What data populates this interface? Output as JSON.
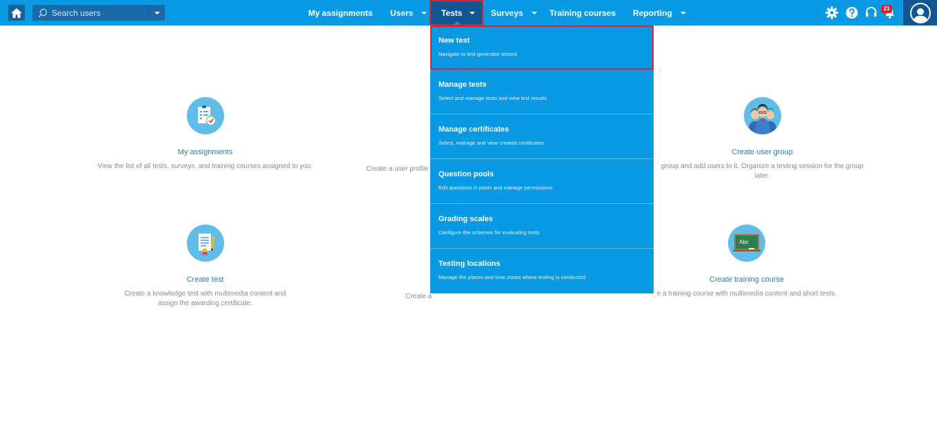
{
  "header": {
    "search": {
      "placeholder": "Search users",
      "value": ""
    },
    "nav": [
      {
        "label": "My assignments"
      },
      {
        "label": "Users"
      },
      {
        "label": "Tests"
      },
      {
        "label": "Surveys"
      },
      {
        "label": "Training courses"
      },
      {
        "label": "Reporting"
      }
    ],
    "notification_count": "21",
    "icons": [
      "home-icon",
      "search-icon",
      "gear-icon",
      "help-icon",
      "headset-icon",
      "bell-icon",
      "user-avatar-icon"
    ]
  },
  "cards": [
    {
      "title": "My assignments",
      "desc": "View the list of all tests, surveys, and training courses assigned to you."
    },
    {
      "title": "",
      "desc": "Create a user profile"
    },
    {
      "title": "Create user group",
      "desc": "group and add users to it. Organize a testing session for the group later."
    },
    {
      "title": "Create test",
      "desc": "Create a knowledge test with multimedia content and assign the awarding certificate."
    },
    {
      "title": "",
      "desc": "Create a"
    },
    {
      "title": "Create training course",
      "desc": "e a training course with multimedia content and short tests."
    }
  ],
  "tests_menu": [
    {
      "title": "New test",
      "sub": "Navigate to test generator wizard"
    },
    {
      "title": "Manage tests",
      "sub": "Select and manage tests and view test results"
    },
    {
      "title": "Manage certificates",
      "sub": "Select, manage and view created certificates"
    },
    {
      "title": "Question pools",
      "sub": "Edit questions in pools and manage permissions"
    },
    {
      "title": "Grading scales",
      "sub": "Configure the schemes for evaluating tests"
    },
    {
      "title": "Testing locations",
      "sub": "Manage the places and time zones where testing is conducted"
    }
  ],
  "colors": {
    "primary": "#0a9ae4",
    "dark": "#125793",
    "highlight": "#e3202a",
    "link": "#2a7bbf"
  }
}
